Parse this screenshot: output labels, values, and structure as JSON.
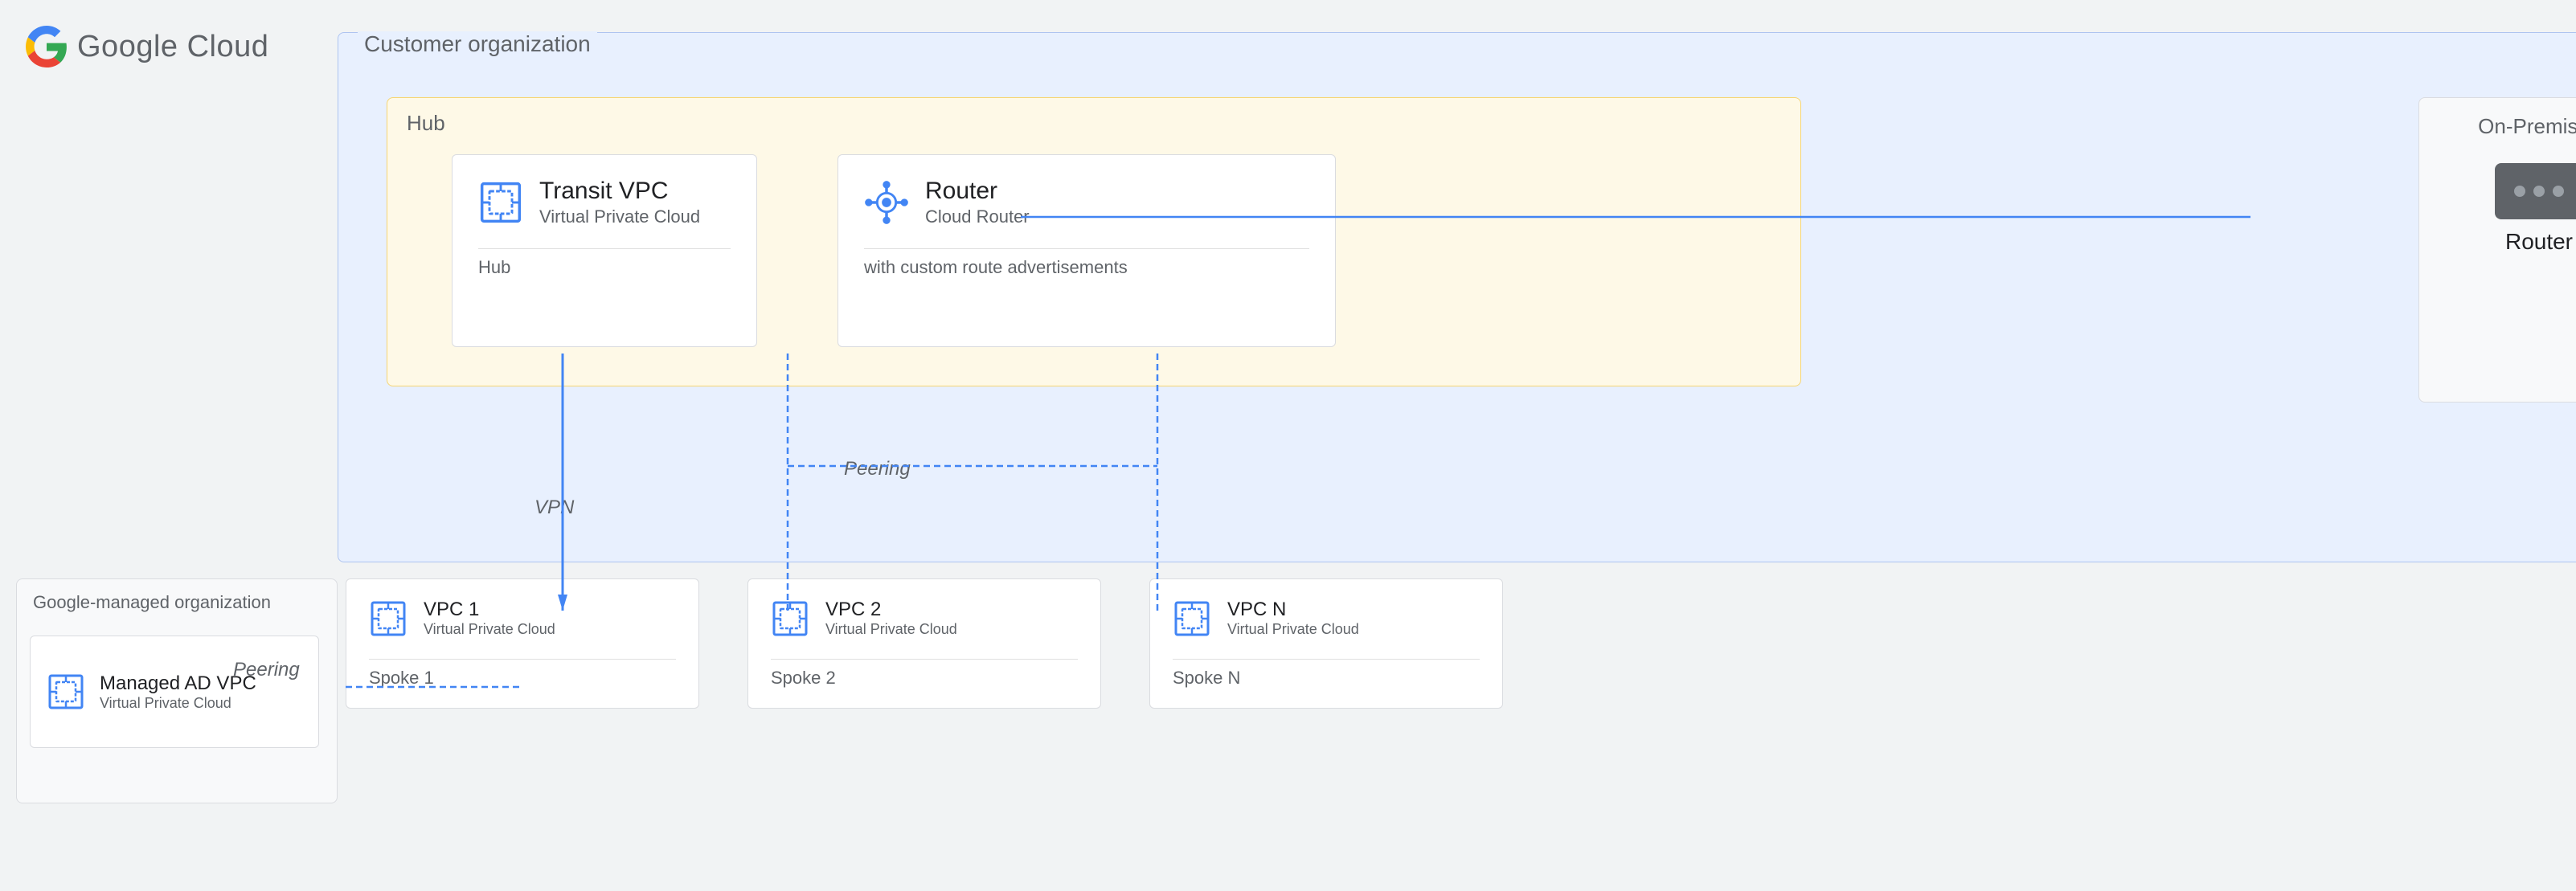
{
  "logo": {
    "text": "Google Cloud"
  },
  "customer_org": {
    "label": "Customer organization",
    "hub": {
      "label": "Hub",
      "transit_vpc": {
        "title": "Transit VPC",
        "subtitle": "Virtual Private Cloud",
        "footer": "Hub"
      },
      "router": {
        "title": "Router",
        "subtitle": "Cloud Router",
        "footer": "with custom route advertisements"
      }
    }
  },
  "on_premises": {
    "label": "On-Premises",
    "router": {
      "label": "Router"
    }
  },
  "google_org": {
    "label": "Google-managed organization",
    "managed_ad": {
      "title": "Managed AD VPC",
      "subtitle": "Virtual Private Cloud"
    }
  },
  "spokes": [
    {
      "title": "VPC 1",
      "subtitle": "Virtual Private Cloud",
      "footer": "Spoke 1"
    },
    {
      "title": "VPC 2",
      "subtitle": "Virtual Private Cloud",
      "footer": "Spoke 2"
    },
    {
      "title": "VPC N",
      "subtitle": "Virtual Private Cloud",
      "footer": "Spoke N"
    }
  ],
  "connections": {
    "vpn_label": "VPN",
    "peering_label_1": "Peering",
    "peering_label_2": "Peering"
  },
  "colors": {
    "blue": "#1a73e8",
    "blue_light": "#4285f4",
    "line_blue": "#4285f4",
    "dot_line": "#4285f4"
  }
}
